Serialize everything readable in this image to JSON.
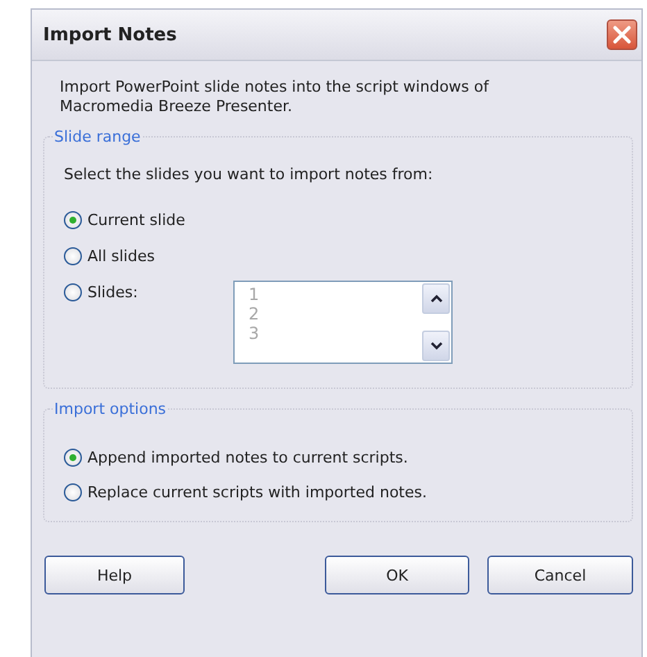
{
  "window": {
    "title": "Import Notes"
  },
  "description": "Import PowerPoint slide notes into the script windows of Macromedia Breeze Presenter.",
  "slide_range": {
    "legend": "Slide range",
    "prompt": "Select the slides you want to import notes from:",
    "options": [
      {
        "label": "Current slide",
        "selected": true
      },
      {
        "label": "All slides",
        "selected": false
      },
      {
        "label": "Slides:",
        "selected": false
      }
    ],
    "slides_list": {
      "disabled": true,
      "items": [
        "1",
        "2",
        "3"
      ]
    }
  },
  "import_options": {
    "legend": "Import options",
    "options": [
      {
        "label": "Append imported notes to current scripts.",
        "selected": true
      },
      {
        "label": "Replace current scripts with imported notes.",
        "selected": false
      }
    ]
  },
  "buttons": [
    {
      "label": "Help",
      "kind": "help"
    },
    {
      "label": "OK",
      "kind": "ok"
    },
    {
      "label": "Cancel",
      "kind": "cancel"
    }
  ]
}
